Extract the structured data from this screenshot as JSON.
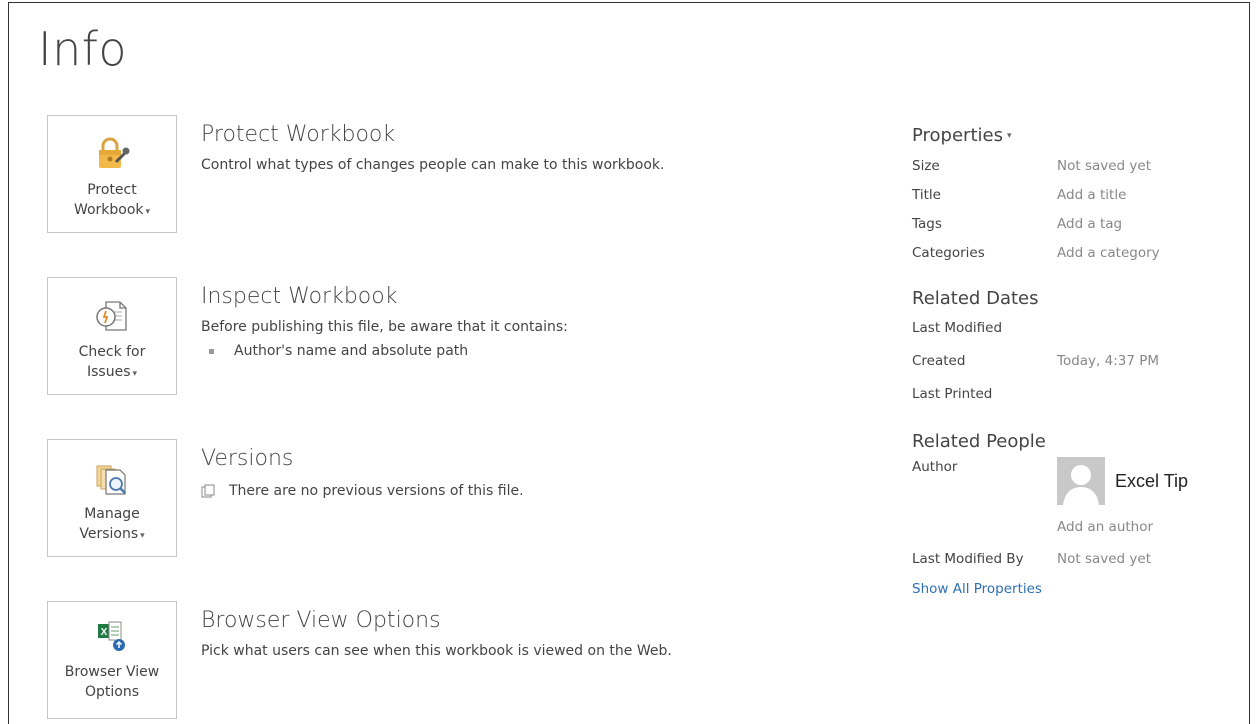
{
  "page": {
    "title": "Info"
  },
  "sections": [
    {
      "tile_label_line1": "Protect",
      "tile_label_line2": "Workbook",
      "title": "Protect Workbook",
      "description": "Control what types of changes people can make to this workbook.",
      "icon": "lock-key-icon"
    },
    {
      "tile_label_line1": "Check for",
      "tile_label_line2": "Issues",
      "title": "Inspect Workbook",
      "description": "Before publishing this file, be aware that it contains:",
      "bullets": [
        "Author's name and absolute path"
      ],
      "icon": "inspect-document-icon"
    },
    {
      "tile_label_line1": "Manage",
      "tile_label_line2": "Versions",
      "title": "Versions",
      "description": "There are no previous versions of this file.",
      "icon": "manage-versions-icon"
    },
    {
      "tile_label_line1": "Browser View",
      "tile_label_line2": "Options",
      "title": "Browser View Options",
      "description": "Pick what users can see when this workbook is viewed on the Web.",
      "icon": "excel-browser-icon"
    }
  ],
  "properties": {
    "heading": "Properties",
    "rows": [
      {
        "key": "Size",
        "value": "Not saved yet"
      },
      {
        "key": "Title",
        "value": "Add a title"
      },
      {
        "key": "Tags",
        "value": "Add a tag"
      },
      {
        "key": "Categories",
        "value": "Add a category"
      }
    ]
  },
  "related_dates": {
    "heading": "Related Dates",
    "rows": [
      {
        "key": "Last Modified",
        "value": ""
      },
      {
        "key": "Created",
        "value": "Today, 4:37 PM"
      },
      {
        "key": "Last Printed",
        "value": ""
      }
    ]
  },
  "related_people": {
    "heading": "Related People",
    "author_label": "Author",
    "author_name": "Excel Tip",
    "add_author": "Add an author",
    "last_modified_by_label": "Last Modified By",
    "last_modified_by_value": "Not saved yet",
    "show_all": "Show All Properties"
  },
  "colors": {
    "link": "#2e6fb5",
    "muted": "#888888",
    "text": "#444444"
  }
}
